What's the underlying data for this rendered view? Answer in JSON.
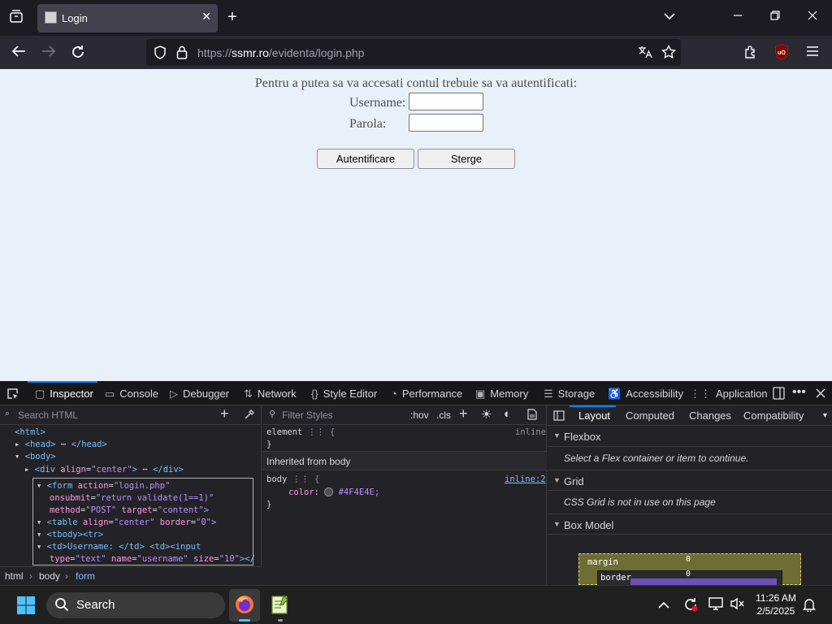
{
  "browser": {
    "tab_title": "Login",
    "url_prefix": "https://",
    "url_domain": "ssmr.ro",
    "url_path": "/evidenta/login.php"
  },
  "page": {
    "message": "Pentru a putea sa va accesati contul trebuie sa va autentificati:",
    "username_label": "Username:",
    "password_label": "Parola:",
    "username_value": "",
    "password_value": "",
    "login_button": "Autentificare",
    "clear_button": "Sterge"
  },
  "devtools": {
    "tabs": [
      "Inspector",
      "Console",
      "Debugger",
      "Network",
      "Style Editor",
      "Performance",
      "Memory",
      "Storage",
      "Accessibility",
      "Application"
    ],
    "search_placeholder": "Search HTML",
    "html_tree": {
      "html": "<html>",
      "head_open": "<head>",
      "head_close": "</head>",
      "body": "<body>",
      "div_open": "<div ",
      "div_attr": "align",
      "div_val": "\"center\"",
      "div_close": "</div>",
      "form_l1_tag": "<form ",
      "form_l1_attr": "action",
      "form_l1_val": "\"login.php\"",
      "form_l2_attr": "onsubmit",
      "form_l2_val": "\"return validate(1==1)\"",
      "form_l3_attr1": "method",
      "form_l3_val1": "\"POST\"",
      "form_l3_attr2": "target",
      "form_l3_val2": "\"content\"",
      "table_tag": "<table ",
      "table_attr1": "align",
      "table_val1": "\"center\"",
      "table_attr2": "border",
      "table_val2": "\"0\"",
      "tbody": "<tbody><tr>",
      "td_line": "<td>Username: </td> <td><input",
      "input_attr1": "type",
      "input_val1": "\"text\"",
      "input_attr2": "name",
      "input_val2": "\"username\"",
      "input_attr3": "size",
      "input_val3": "\"10\"",
      "input_end": "></"
    },
    "breadcrumb": [
      "html",
      "body",
      "form"
    ],
    "rules": {
      "filter_placeholder": "Filter Styles",
      "hov": ":hov",
      "cls": ".cls",
      "element_selector": "element",
      "element_source": "inline",
      "inherited_header": "Inherited from body",
      "body_selector": "body",
      "body_source": "inline:2",
      "color_prop": "color",
      "color_value": "#4F4E4E;",
      "color_swatch": "#4f4e4e"
    },
    "layout": {
      "tabs": [
        "Layout",
        "Computed",
        "Changes",
        "Compatibility"
      ],
      "flexbox_title": "Flexbox",
      "flexbox_note": "Select a Flex container or item to continue.",
      "grid_title": "Grid",
      "grid_note": "CSS Grid is not in use on this page",
      "boxmodel_title": "Box Model",
      "margin_label": "margin",
      "margin_value": "0",
      "border_label": "border",
      "border_value": "0"
    }
  },
  "taskbar": {
    "search_label": "Search",
    "time": "11:26 AM",
    "date": "2/5/2025"
  }
}
